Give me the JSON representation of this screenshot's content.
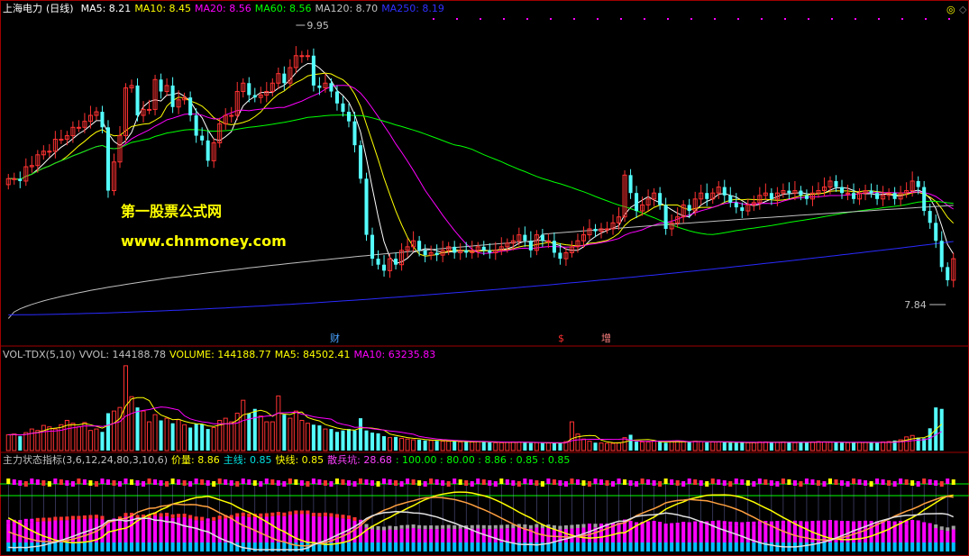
{
  "main_header": {
    "stock": "上海电力",
    "period": "(日线)",
    "ma_items": [
      {
        "label": "MA5: 8.21",
        "color": "#ffffff"
      },
      {
        "label": "MA10: 8.45",
        "color": "#ffff00"
      },
      {
        "label": "MA20: 8.56",
        "color": "#ff00ff"
      },
      {
        "label": "MA60: 8.56",
        "color": "#00ff00"
      },
      {
        "label": "MA120: 8.70",
        "color": "#c0c0c0"
      },
      {
        "label": "MA250: 8.19",
        "color": "#3030ff"
      }
    ]
  },
  "watermark": {
    "line1": "第一股票公式网",
    "line2": "www.chnmoney.com"
  },
  "markers": {
    "high": "9.95",
    "low": "7.84"
  },
  "events": [
    {
      "text": "财",
      "color": "#4aa3ff"
    },
    {
      "text": "$",
      "color": "#ff3030"
    },
    {
      "text": "增",
      "color": "#ff8080"
    }
  ],
  "vol_header": {
    "name": "VOL-TDX(5,10)",
    "items": [
      {
        "label": "VVOL: 144188.78",
        "color": "#c0c0c0"
      },
      {
        "label": "VOLUME: 144188.77",
        "color": "#ffff00"
      },
      {
        "label": "MA5: 84502.41",
        "color": "#ffff00"
      },
      {
        "label": "MA10: 63235.83",
        "color": "#ff00ff"
      }
    ]
  },
  "ind_header": {
    "name": "主力状态指标(3,6,12,24,80,3,10,6)",
    "items": [
      {
        "label": "价量: 8.86",
        "color": "#ffff00"
      },
      {
        "label": "主线: 0.85",
        "color": "#00e0e0"
      },
      {
        "label": "快线: 0.85",
        "color": "#ffff00"
      },
      {
        "label": "散兵坑: 28.68",
        "color": "#ff40ff"
      },
      {
        "label": ": 100.00 : 80.00 : 8.86 : 0.85 : 0.85",
        "color": "#00ff00"
      }
    ]
  },
  "chart_data": {
    "type": "candlestick",
    "price_range": [
      7.5,
      10.05
    ],
    "close": [
      8.72,
      8.72,
      8.7,
      8.82,
      8.83,
      8.92,
      8.95,
      8.95,
      9.05,
      9.05,
      9.08,
      9.15,
      9.15,
      9.2,
      9.25,
      9.28,
      9.15,
      8.62,
      8.86,
      9.08,
      9.48,
      9.5,
      9.25,
      9.3,
      9.3,
      9.55,
      9.45,
      9.5,
      9.32,
      9.38,
      9.4,
      9.25,
      9.08,
      9.04,
      8.87,
      9.02,
      9.18,
      9.25,
      9.25,
      9.45,
      9.52,
      9.42,
      9.4,
      9.42,
      9.45,
      9.52,
      9.6,
      9.52,
      9.65,
      9.75,
      9.75,
      9.75,
      9.5,
      9.48,
      9.52,
      9.45,
      9.35,
      9.28,
      9.2,
      9.0,
      8.72,
      8.25,
      8.05,
      8.0,
      7.95,
      8.05,
      8.0,
      8.12,
      8.15,
      8.2,
      8.12,
      8.08,
      8.1,
      8.08,
      8.12,
      8.15,
      8.1,
      8.12,
      8.1,
      8.12,
      8.15,
      8.12,
      8.1,
      8.12,
      8.15,
      8.18,
      8.2,
      8.25,
      8.2,
      8.12,
      8.25,
      8.2,
      8.2,
      8.1,
      8.05,
      8.1,
      8.15,
      8.2,
      8.25,
      8.3,
      8.28,
      8.3,
      8.3,
      8.35,
      8.4,
      8.75,
      8.6,
      8.45,
      8.5,
      8.55,
      8.6,
      8.5,
      8.3,
      8.35,
      8.4,
      8.5,
      8.45,
      8.55,
      8.6,
      8.55,
      8.6,
      8.65,
      8.58,
      8.52,
      8.48,
      8.45,
      8.5,
      8.52,
      8.58,
      8.6,
      8.55,
      8.6,
      8.62,
      8.6,
      8.62,
      8.58,
      8.55,
      8.6,
      8.62,
      8.65,
      8.7,
      8.65,
      8.6,
      8.6,
      8.55,
      8.6,
      8.62,
      8.6,
      8.55,
      8.58,
      8.6,
      8.55,
      8.6,
      8.62,
      8.7,
      8.65,
      8.45,
      8.35,
      8.2,
      7.98,
      7.87,
      8.05
    ],
    "volume": [
      22000,
      23000,
      20000,
      25000,
      30000,
      28000,
      35000,
      33000,
      30000,
      36000,
      42000,
      38000,
      33000,
      39000,
      28000,
      30000,
      26000,
      52000,
      55000,
      60000,
      118000,
      75000,
      60000,
      55000,
      40000,
      50000,
      42000,
      45000,
      38000,
      43000,
      36000,
      32000,
      37000,
      37000,
      30000,
      32000,
      42000,
      45000,
      40000,
      52000,
      70000,
      52000,
      58000,
      48000,
      40000,
      40000,
      76000,
      50000,
      45000,
      55000,
      42000,
      38000,
      36000,
      35000,
      30000,
      30000,
      26000,
      28000,
      30000,
      28000,
      45000,
      28000,
      25000,
      24000,
      20000,
      18000,
      19000,
      17000,
      16000,
      15000,
      15000,
      14000,
      14000,
      13500,
      13000,
      13000,
      12500,
      12000,
      12000,
      12000,
      12500,
      12000,
      11500,
      11000,
      11000,
      11500,
      12000,
      12000,
      11000,
      10500,
      11000,
      10500,
      10500,
      10500,
      10000,
      12500,
      40000,
      23000,
      16000,
      13000,
      11000,
      10500,
      10000,
      10000,
      11000,
      18000,
      22000,
      12500,
      12000,
      12000,
      13000,
      12000,
      11000,
      12500,
      13500,
      12500,
      12000,
      13000,
      12500,
      11500,
      12000,
      12000,
      11500,
      11000,
      11000,
      11500,
      11000,
      11000,
      12000,
      12000,
      11500,
      11500,
      12000,
      11500,
      11000,
      11500,
      12000,
      12000,
      12500,
      12000,
      11500,
      11500,
      11000,
      11000,
      11500,
      11500,
      11500,
      11000,
      11000,
      12000,
      12500,
      14000,
      15000,
      19000,
      21000,
      18000,
      17000,
      31000,
      60000,
      58000
    ],
    "ma_lines": [
      "MA5",
      "MA10",
      "MA20",
      "MA60",
      "MA120",
      "MA250"
    ]
  }
}
